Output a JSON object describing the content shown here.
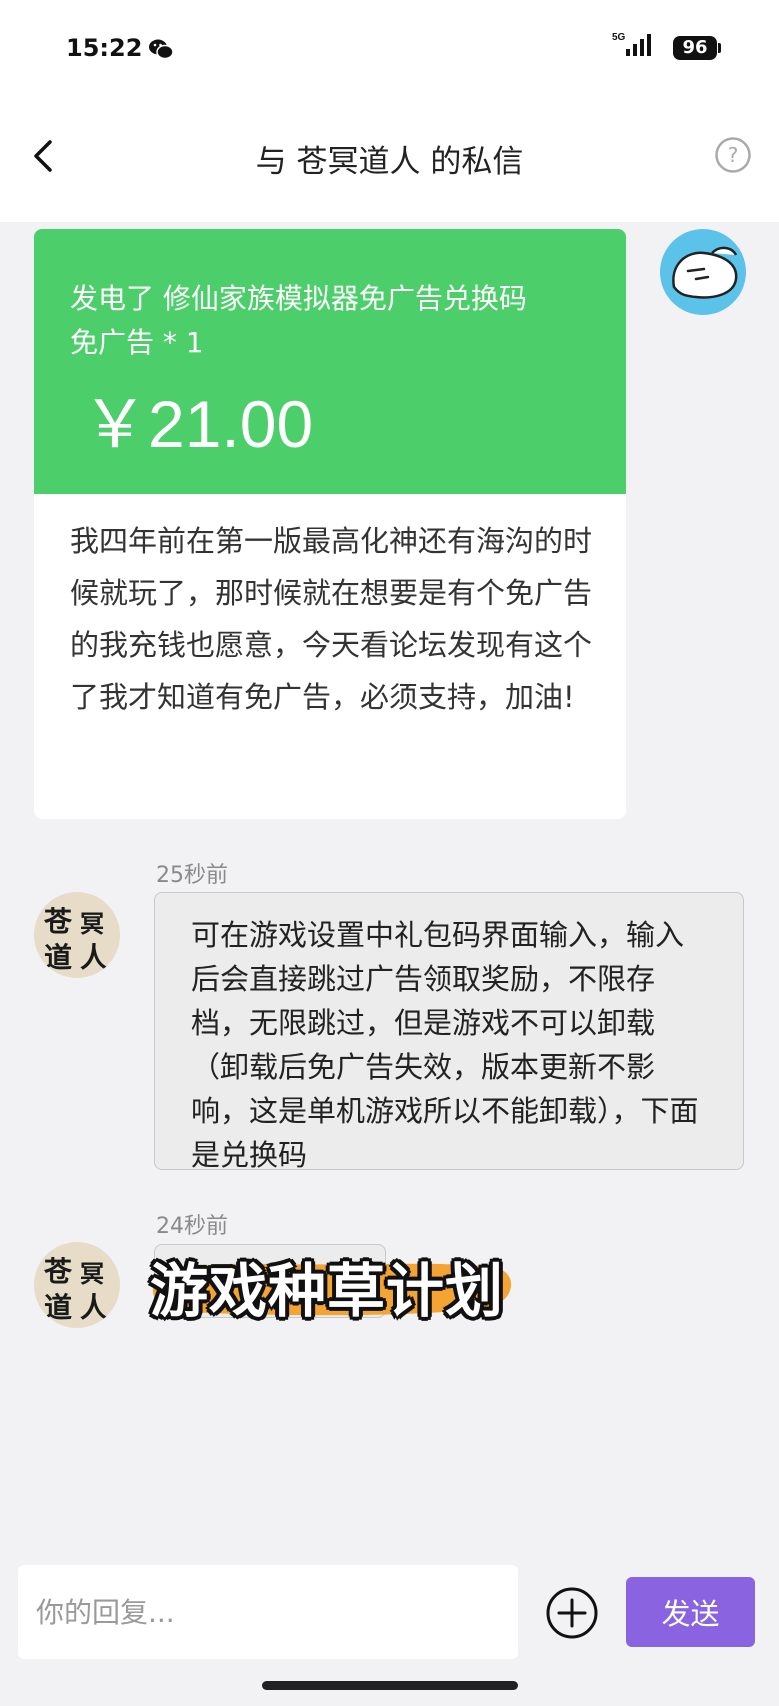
{
  "status_bar": {
    "time": "15:22",
    "network": "5G",
    "battery": "96"
  },
  "nav": {
    "title": "与 苍冥道人 的私信"
  },
  "gift_card": {
    "line1": "发电了 修仙家族模拟器免广告兑换码",
    "line2": "免广告 * 1",
    "price": "￥21.00",
    "message": "我四年前在第一版最高化神还有海沟的时候就玩了，那时候就在想要是有个免广告的我充钱也愿意，今天看论坛发现有这个了我才知道有免广告，必须支持，加油!",
    "accent_color": "#4ccf6b"
  },
  "messages": [
    {
      "time": "25秒前",
      "text": "可在游戏设置中礼包码界面输入，输入后会直接跳过广告领取奖励，不限存档，无限跳过，但是游戏不可以卸载（卸载后免广告失效，版本更新不影响，这是单机游戏所以不能卸载），下面是兑换码"
    },
    {
      "time": "24秒前",
      "text": ""
    }
  ],
  "sender_avatar_text": [
    "苍",
    "冥",
    "道",
    "人"
  ],
  "watermark": "游戏种草计划",
  "composer": {
    "placeholder": "你的回复...",
    "send_label": "发送",
    "send_color": "#8a63e0"
  }
}
